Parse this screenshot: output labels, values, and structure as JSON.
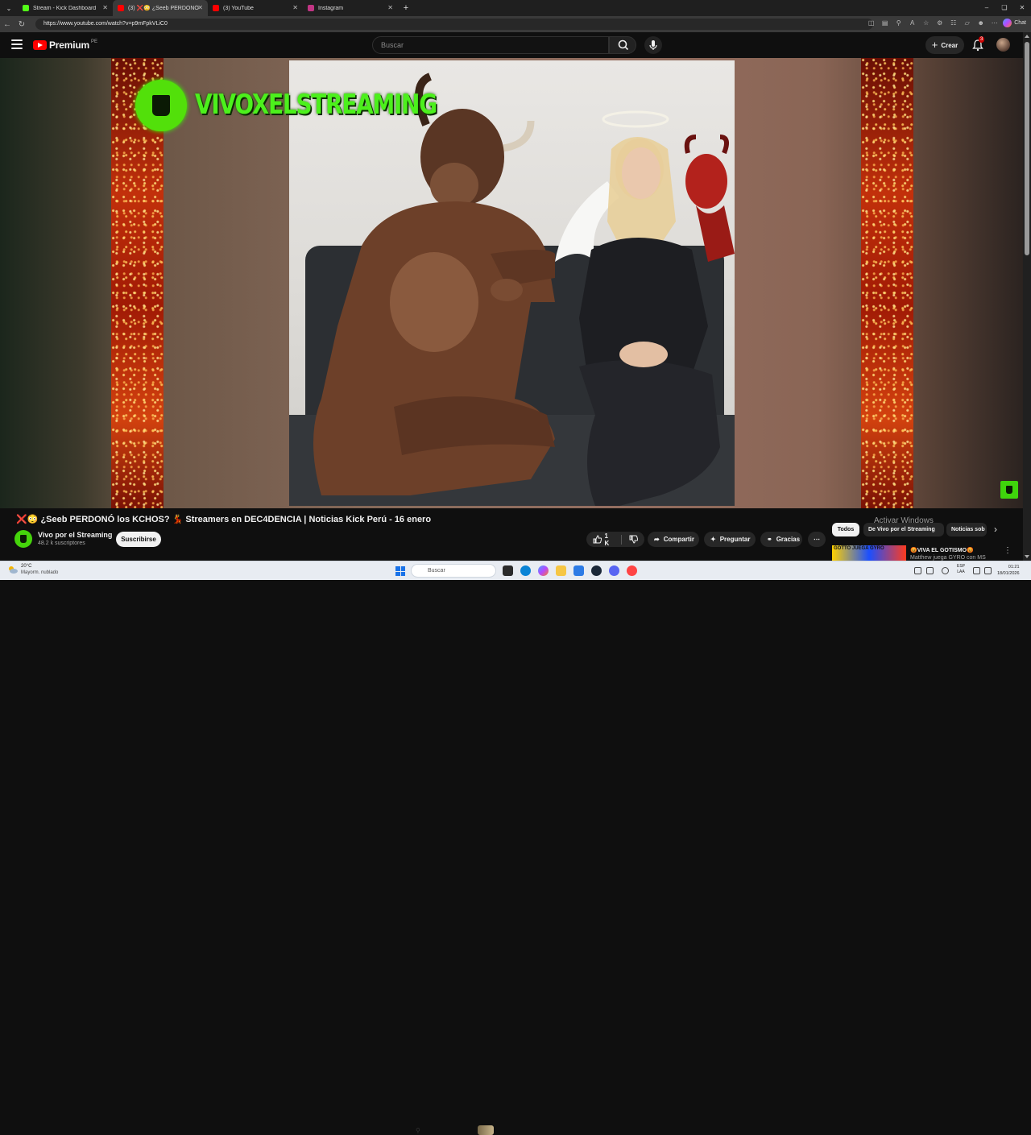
{
  "browser": {
    "tabs": [
      {
        "label": "Stream - Kick Dashboard",
        "color": "#53fc18",
        "active": false
      },
      {
        "label": "(3) ❌😳 ¿Seeb PERDONÓ lo...",
        "color": "#ff0000",
        "active": true
      },
      {
        "label": "(3) YouTube",
        "color": "#ff0000",
        "active": false
      },
      {
        "label": "Instagram",
        "color": "#c13584",
        "active": false
      }
    ],
    "new_tab": "+",
    "url": "https://www.youtube.com/watch?v=p9mFpkVLiC0",
    "chat_label": "Chat"
  },
  "youtube": {
    "logo_text": "Premium",
    "country_code": "PE",
    "search_placeholder": "Buscar",
    "create_label": "Crear",
    "notification_count": "3"
  },
  "overlay": {
    "brand_text": "VIVOXELSTREAMING"
  },
  "video": {
    "title": "❌😳 ¿Seeb PERDONÓ los KCHOS? 💃 Streamers en DEC4DENCIA | Noticias Kick Perú - 16 enero",
    "channel_name": "Vivo por el Streaming",
    "subscribers": "48.2 k suscriptores",
    "subscribe_label": "Suscribirse",
    "likes": "1 K",
    "share_label": "Compartir",
    "ask_label": "Preguntar",
    "thanks_label": "Gracias"
  },
  "watermark": "Activar Windows",
  "chips": [
    "Todos",
    "De Vivo por el Streaming",
    "Noticias sob"
  ],
  "recommended": {
    "thumb_text": "GOTTO JUEGA GYRO",
    "title": "😡VIVA EL GOTISMO😡",
    "subtitle": "Matthew juega GYRO con MS"
  },
  "taskbar": {
    "temperature": "20°C",
    "weather": "Mayorm. nublado",
    "search_placeholder": "Buscar",
    "lang_top": "ESP",
    "lang_bottom": "LAA",
    "time": "01:21",
    "date": "18/01/2026"
  },
  "colors": {
    "kick_green": "#53fc18",
    "youtube_red": "#ff0000",
    "background": "#0f0f0f"
  }
}
